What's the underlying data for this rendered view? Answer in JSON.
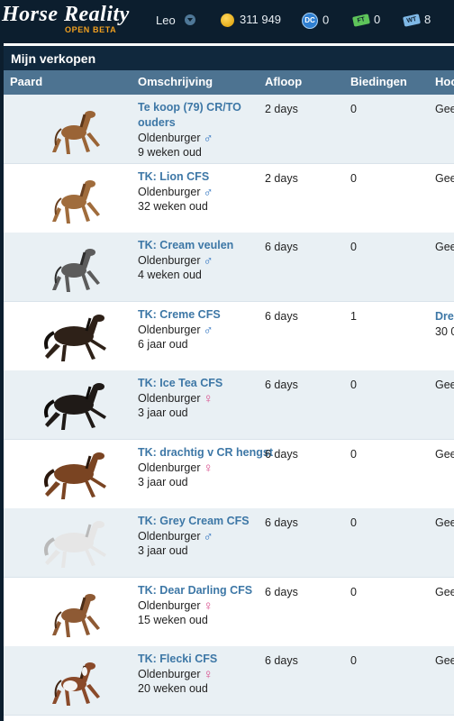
{
  "header": {
    "logo_main": "Horse Reality",
    "logo_sub": "OPEN BETA",
    "username": "Leo",
    "currencies": [
      {
        "icon": "coin-icon",
        "value": "311 949"
      },
      {
        "icon": "dc-icon",
        "label": "DC",
        "value": "0"
      },
      {
        "icon": "ft-ticket-icon",
        "label": "FT",
        "value": "0"
      },
      {
        "icon": "wt-ticket-icon",
        "label": "WT",
        "value": "8"
      }
    ]
  },
  "panel": {
    "title": "Mijn verkopen",
    "columns": [
      "Paard",
      "Omschrijving",
      "Afloop",
      "Biedingen",
      "Hoo"
    ]
  },
  "rows": [
    {
      "title": "Te koop (79) CR/TO ouders",
      "breed": "Oldenburger",
      "sex": "♂",
      "age": "9 weken oud",
      "expires": "2 days",
      "bids": "0",
      "highest": "Gee",
      "horse": {
        "coat": "#9a6436",
        "mane": "#5b3518",
        "foal": true
      }
    },
    {
      "title": "TK: Lion CFS",
      "breed": "Oldenburger",
      "sex": "♂",
      "age": "32 weken oud",
      "expires": "2 days",
      "bids": "0",
      "highest": "Gee",
      "horse": {
        "coat": "#a06c3c",
        "mane": "#6a4020",
        "foal": true
      }
    },
    {
      "title": "TK: Cream veulen",
      "breed": "Oldenburger",
      "sex": "♂",
      "age": "4 weken oud",
      "expires": "6 days",
      "bids": "0",
      "highest": "Gee",
      "horse": {
        "coat": "#5c5c5c",
        "mane": "#2b2b2b",
        "foal": true
      }
    },
    {
      "title": "TK: Creme CFS",
      "breed": "Oldenburger",
      "sex": "♂",
      "age": "6 jaar oud",
      "expires": "6 days",
      "bids": "1",
      "highest_bidder": "Drea",
      "highest_amount": "30 0",
      "horse": {
        "coat": "#2e2118",
        "mane": "#14100c",
        "foal": false
      }
    },
    {
      "title": "TK: Ice Tea CFS",
      "breed": "Oldenburger",
      "sex": "♀",
      "age": "3 jaar oud",
      "expires": "6 days",
      "bids": "0",
      "highest": "Gee",
      "horse": {
        "coat": "#1f1a17",
        "mane": "#0c0a08",
        "foal": false
      }
    },
    {
      "title": "TK: drachtig v CR hengst",
      "breed": "Oldenburger",
      "sex": "♀",
      "age": "3 jaar oud",
      "expires": "6 days",
      "bids": "0",
      "highest": "Gee",
      "horse": {
        "coat": "#7a4422",
        "mane": "#2a170c",
        "foal": false
      }
    },
    {
      "title": "TK: Grey Cream CFS",
      "breed": "Oldenburger",
      "sex": "♂",
      "age": "3 jaar oud",
      "expires": "6 days",
      "bids": "0",
      "highest": "Gee",
      "horse": {
        "coat": "#e6e6e6",
        "mane": "#b9b9b9",
        "foal": false
      }
    },
    {
      "title": "TK: Dear Darling CFS",
      "breed": "Oldenburger",
      "sex": "♀",
      "age": "15 weken oud",
      "expires": "6 days",
      "bids": "0",
      "highest": "Gee",
      "horse": {
        "coat": "#8e5a34",
        "mane": "#4a2c16",
        "foal": true
      }
    },
    {
      "title": "TK: Flecki CFS",
      "breed": "Oldenburger",
      "sex": "♀",
      "age": "20 weken oud",
      "expires": "6 days",
      "bids": "0",
      "highest": "Gee",
      "horse": {
        "coat": "#8a4a2a",
        "mane": "#3e2210",
        "foal": true,
        "pinto": true
      }
    }
  ]
}
